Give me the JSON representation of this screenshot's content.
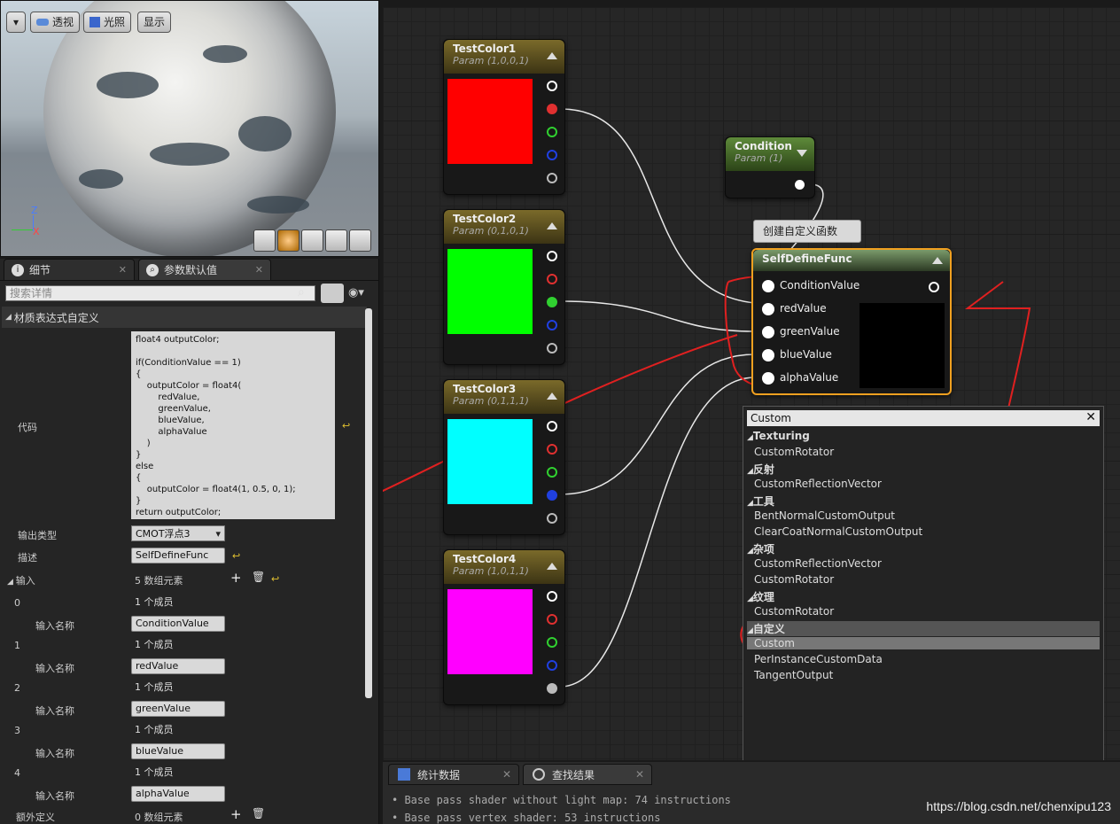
{
  "viewport": {
    "btn_perspective": "透视",
    "btn_lit": "光照",
    "btn_show": "显示",
    "axis_z": "Z",
    "axis_x": "X"
  },
  "details": {
    "tab_details": "细节",
    "tab_params": "参数默认值",
    "search_placeholder": "搜索详情",
    "category": "材质表达式自定义",
    "code_label": "代码",
    "code": "float4 outputColor;\n\nif(ConditionValue == 1)\n{\n    outputColor = float4(\n        redValue,\n        greenValue,\n        blueValue,\n        alphaValue\n    )\n}\nelse\n{\n    outputColor = float4(1, 0.5, 0, 1);\n}\nreturn outputColor;",
    "output_type_label": "输出类型",
    "output_type_value": "CMOT浮点3",
    "desc_label": "描述",
    "desc_value": "SelfDefineFunc",
    "inputs_label": "输入",
    "inputs_count": "5 数组元素",
    "member_count": "1 个成员",
    "input_name_label": "输入名称",
    "inputs": [
      {
        "idx": "0",
        "name": "ConditionValue"
      },
      {
        "idx": "1",
        "name": "redValue"
      },
      {
        "idx": "2",
        "name": "greenValue"
      },
      {
        "idx": "3",
        "name": "blueValue"
      },
      {
        "idx": "4",
        "name": "alphaValue"
      }
    ],
    "extra_label": "额外定义",
    "extra_count": "0 数组元素"
  },
  "graph": {
    "nodes": [
      {
        "title": "TestColor1",
        "sub": "Param (1,0,0,1)",
        "color": "#ff0000"
      },
      {
        "title": "TestColor2",
        "sub": "Param (0,1,0,1)",
        "color": "#00ff00"
      },
      {
        "title": "TestColor3",
        "sub": "Param (0,1,1,1)",
        "color": "#00ffff"
      },
      {
        "title": "TestColor4",
        "sub": "Param (1,0,1,1)",
        "color": "#ff00ff"
      }
    ],
    "condition": {
      "title": "Condition",
      "sub": "Param (1)"
    },
    "tooltip": "创建自定义函数",
    "custom": {
      "title": "SelfDefineFunc",
      "pins": [
        "ConditionValue",
        "redValue",
        "greenValue",
        "blueValue",
        "alphaValue"
      ]
    }
  },
  "popup": {
    "search": "Custom",
    "groups": [
      {
        "cat": "Texturing",
        "items": [
          "CustomRotator"
        ]
      },
      {
        "cat": "反射",
        "items": [
          "CustomReflectionVector"
        ]
      },
      {
        "cat": "工具",
        "items": [
          "BentNormalCustomOutput",
          "ClearCoatNormalCustomOutput"
        ]
      },
      {
        "cat": "杂项",
        "items": [
          "CustomReflectionVector",
          "CustomRotator"
        ]
      },
      {
        "cat": "纹理",
        "items": [
          "CustomRotator"
        ]
      },
      {
        "cat": "自定义",
        "items": [
          "Custom",
          "PerInstanceCustomData",
          "TangentOutput"
        ]
      }
    ]
  },
  "bottom": {
    "tab_stats": "统计数据",
    "tab_find": "查找结果",
    "log1": "• Base pass shader without light map: 74 instructions",
    "log2": "• Base pass vertex shader: 53 instructions"
  },
  "watermark": "https://blog.csdn.net/chenxipu123"
}
